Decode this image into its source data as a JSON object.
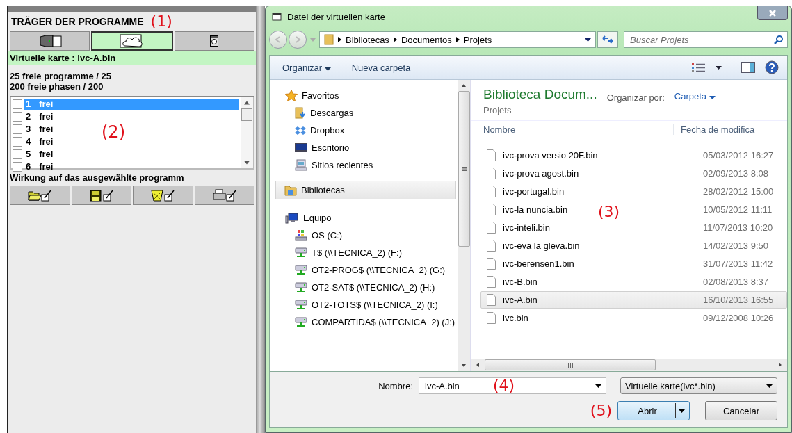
{
  "carrier_panel": {
    "title": "TRÄGER DER PROGRAMME",
    "annotation": "(1)",
    "carriers": [
      {
        "kind": "reader",
        "selected": false
      },
      {
        "kind": "cloud",
        "selected": true
      },
      {
        "kind": "machine",
        "selected": false
      }
    ],
    "card_label": "Virtuelle karte : ivc-A.bin",
    "stats": [
      " 25 freie programme / 25",
      "200 freie phasen / 200"
    ],
    "programs": [
      {
        "number": "1",
        "name": "frei",
        "checked": false,
        "selected": true
      },
      {
        "number": "2",
        "name": "frei",
        "checked": false,
        "selected": false
      },
      {
        "number": "3",
        "name": "frei",
        "checked": false,
        "selected": false
      },
      {
        "number": "4",
        "name": "frei",
        "checked": false,
        "selected": false
      },
      {
        "number": "5",
        "name": "frei",
        "checked": false,
        "selected": false
      },
      {
        "number": "6",
        "name": "frei",
        "checked": false,
        "selected": false
      }
    ],
    "list_annotation": "(2)",
    "action_label": "Wirkung auf das ausgewählte programm",
    "actions": [
      {
        "kind": "open"
      },
      {
        "kind": "save"
      },
      {
        "kind": "delete"
      },
      {
        "kind": "print"
      }
    ]
  },
  "dialog": {
    "title": "Datei der virtuellen karte",
    "breadcrumb": [
      "Bibliotecas",
      "Documentos",
      "Projets"
    ],
    "search": {
      "placeholder": "Buscar Projets"
    },
    "toolbar": [
      "Organizar",
      "Nueva carpeta"
    ],
    "nav": [
      {
        "label": "Favoritos",
        "kind": "star",
        "selected": false,
        "children": [
          {
            "label": "Descargas",
            "kind": "download",
            "selected": false
          },
          {
            "label": "Dropbox",
            "kind": "dropbox",
            "selected": false
          },
          {
            "label": "Escritorio",
            "kind": "desktop",
            "selected": false
          },
          {
            "label": "Sitios recientes",
            "kind": "recent",
            "selected": false
          }
        ]
      },
      {
        "label": "Bibliotecas",
        "kind": "library",
        "selected": true
      },
      {
        "label": "Equipo",
        "kind": "computer",
        "selected": false,
        "children": [
          {
            "label": "OS (C:)",
            "kind": "disk",
            "selected": false
          },
          {
            "label": "T$ (\\\\TECNICA_2) (F:)",
            "kind": "network",
            "selected": false
          },
          {
            "label": "OT2-PROG$ (\\\\TECNICA_2) (G:)",
            "kind": "network",
            "selected": false
          },
          {
            "label": "OT2-SAT$ (\\\\TECNICA_2) (H:)",
            "kind": "network",
            "selected": false
          },
          {
            "label": "OT2-TOTS$ (\\\\TECNICA_2) (I:)",
            "kind": "network",
            "selected": false
          },
          {
            "label": "COMPARTIDA$ (\\\\TECNICA_2) (J:)",
            "kind": "network",
            "selected": false
          }
        ]
      }
    ],
    "library_title": "Biblioteca Docum...",
    "library_subtitle": "Projets",
    "arrange_label": "Organizar por:",
    "arrange_value": "Carpeta",
    "columns": [
      "Nombre",
      "Fecha de modifica"
    ],
    "files": [
      {
        "name": "ivc-prova versio 20F.bin",
        "date": "05/03/2012 16:27",
        "selected": false
      },
      {
        "name": "ivc-prova agost.bin",
        "date": "02/09/2013 8:08",
        "selected": false
      },
      {
        "name": "ivc-portugal.bin",
        "date": "28/02/2012 15:00",
        "selected": false
      },
      {
        "name": "ivc-la nuncia.bin",
        "date": "10/05/2012 11:11",
        "selected": false
      },
      {
        "name": "ivc-inteli.bin",
        "date": "11/07/2013 10:20",
        "selected": false
      },
      {
        "name": "ivc-eva la gleva.bin",
        "date": "14/02/2013 9:50",
        "selected": false
      },
      {
        "name": "ivc-berensen1.bin",
        "date": "31/07/2013 11:42",
        "selected": false
      },
      {
        "name": "ivc-B.bin",
        "date": "02/08/2013 8:37",
        "selected": false
      },
      {
        "name": "ivc-A.bin",
        "date": "16/10/2013 16:55",
        "selected": true
      },
      {
        "name": "ivc.bin",
        "date": "09/12/2008 10:26",
        "selected": false
      }
    ],
    "files_annotation": "(3)",
    "filename_label": "Nombre:",
    "filename": "ivc-A.bin",
    "filename_annotation": "(4)",
    "filter": "Virtuelle karte(ivc*.bin)",
    "buttons_annotation": "(5)",
    "buttons": [
      {
        "label": "Abrir",
        "kind": "split"
      },
      {
        "label": "Cancelar",
        "kind": "plain"
      }
    ]
  }
}
